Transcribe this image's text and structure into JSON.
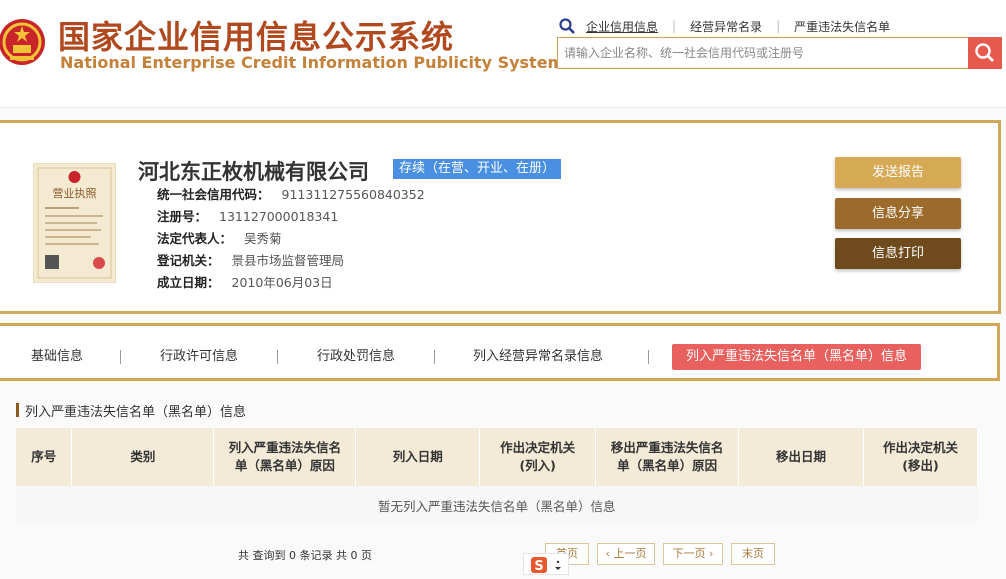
{
  "header": {
    "title_cn": "国家企业信用信息公示系统",
    "title_en": "National Enterprise Credit Information Publicity System",
    "links": [
      "企业信用信息",
      "经营异常名录",
      "严重违法失信名单"
    ],
    "search_placeholder": "请输入企业名称、统一社会信用代码或注册号"
  },
  "company": {
    "name": "河北东正枚机械有限公司",
    "status": "存续（在营、开业、在册）",
    "fields": [
      {
        "label": "统一社会信用代码：",
        "value": "911311275560840352"
      },
      {
        "label": "注册号：",
        "value": "131127000018341"
      },
      {
        "label": "法定代表人：",
        "value": "吴秀菊"
      },
      {
        "label": "登记机关：",
        "value": "景县市场监督管理局"
      },
      {
        "label": "成立日期：",
        "value": "2010年06月03日"
      }
    ],
    "license_text": "营业执照",
    "actions": [
      "发送报告",
      "信息分享",
      "信息打印"
    ]
  },
  "tabs": [
    "基础信息",
    "行政许可信息",
    "行政处罚信息",
    "列入经营异常名录信息",
    "列入严重违法失信名单（黑名单）信息"
  ],
  "section": {
    "title": "列入严重违法失信名单（黑名单）信息",
    "columns": [
      [
        "序号"
      ],
      [
        "类别"
      ],
      [
        "列入严重违法失信名",
        "单（黑名单）原因"
      ],
      [
        "列入日期"
      ],
      [
        "作出决定机关",
        "(列入)"
      ],
      [
        "移出严重违法失信名",
        "单（黑名单）原因"
      ],
      [
        "移出日期"
      ],
      [
        "作出决定机关",
        "(移出)"
      ]
    ],
    "empty_text": "暂无列入严重违法失信名单（黑名单）信息"
  },
  "pager": {
    "info": "共 查询到 0 条记录 共 0 页",
    "buttons": [
      "首页",
      "上一页",
      "下一页",
      "末页"
    ]
  },
  "colors": {
    "title": "#b1491f",
    "accent_gold": "#d0a85c",
    "active_tab": "#e8615e",
    "status_blue": "#4a90e2"
  }
}
